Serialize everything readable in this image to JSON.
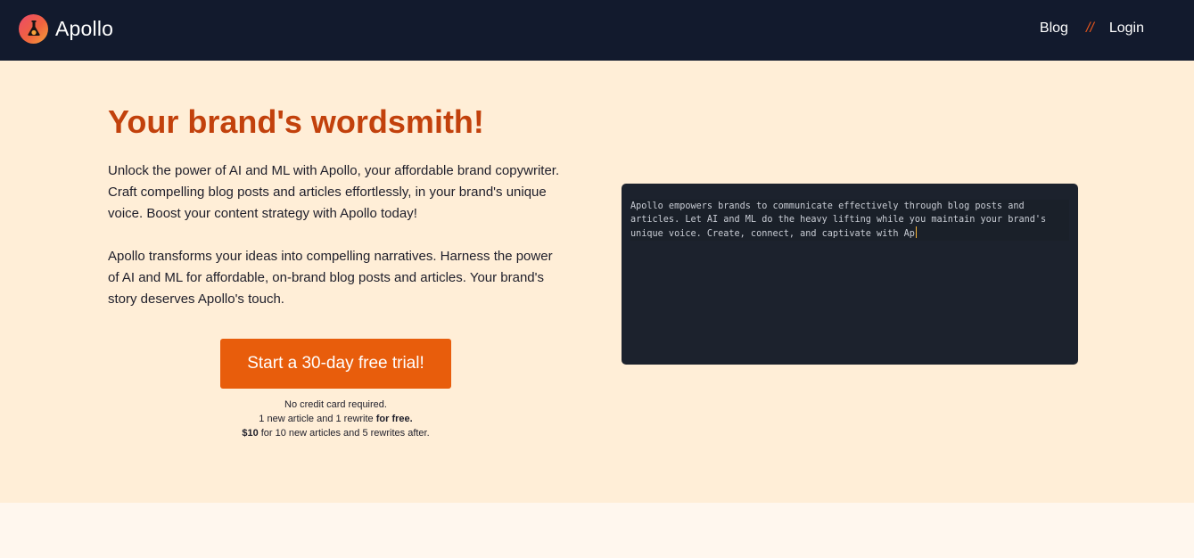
{
  "nav": {
    "brand": "Apollo",
    "logo_icon": "flask-icon",
    "links": [
      "Blog",
      "Login"
    ],
    "separator": "//"
  },
  "hero": {
    "headline": "Your brand's wordsmith!",
    "paragraphs": [
      "Unlock the power of AI and ML with Apollo, your affordable brand copywriter. Craft compelling blog posts and articles effortlessly, in your brand's unique voice. Boost your content strategy with Apollo today!",
      "Apollo transforms your ideas into compelling narratives. Harness the power of AI and ML for affordable, on-brand blog posts and articles. Your brand's story deserves Apollo's touch."
    ],
    "cta_label": "Start a 30-day free trial!",
    "fine_print": {
      "line1": "No credit card required.",
      "line2_prefix": "1 new article and 1 rewrite ",
      "line2_bold": "for free.",
      "line3_bold": "$10",
      "line3_suffix": " for 10 new articles and 5 rewrites after."
    }
  },
  "editor": {
    "typed_text": "Apollo empowers brands to communicate effectively through blog posts and articles. Let AI and ML do the heavy lifting while you maintain your brand's unique voice. Create, connect, and captivate with Ap"
  },
  "colors": {
    "nav_bg": "#121a2d",
    "hero_bg": "#ffeed7",
    "accent": "#e85d0c",
    "headline": "#c2410c",
    "editor_bg": "#1c222d"
  }
}
